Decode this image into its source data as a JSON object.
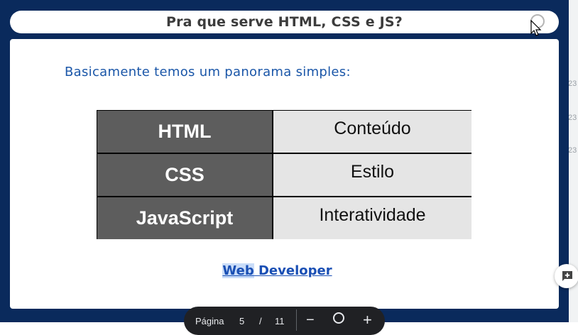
{
  "side_numbers": [
    "23",
    "23",
    "23"
  ],
  "modal": {
    "title": "Pra que serve HTML, CSS e JS?",
    "intro": "Basicamente temos um panorama simples:",
    "table": [
      {
        "key": "HTML",
        "value": "Conteúdo"
      },
      {
        "key": "CSS",
        "value": "Estilo"
      },
      {
        "key": "JavaScript",
        "value": "Interatividade"
      }
    ],
    "link_part1": "Web",
    "link_part2": " Developer"
  },
  "pager": {
    "label": "Página",
    "current": "5",
    "separator": "/",
    "total": "11"
  },
  "icons": {
    "close": "close-icon",
    "cursor": "cursor-icon",
    "zoom_out": "minus-icon",
    "zoom_fit": "zoom-icon",
    "zoom_in": "plus-icon",
    "add_comment": "add-comment-icon"
  },
  "colors": {
    "frame": "#0a2a5c",
    "intro_text": "#1a56a8",
    "link": "#1a4fb4"
  }
}
